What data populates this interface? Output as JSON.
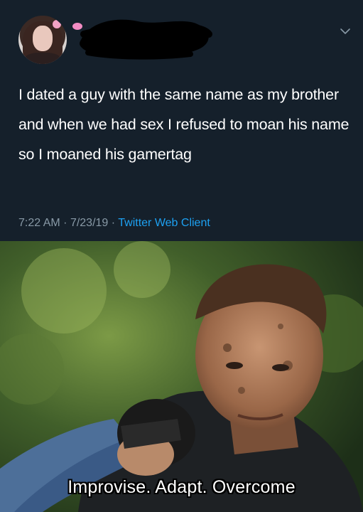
{
  "tweet": {
    "text": "I dated a guy with the same name as my brother and when we had sex I refused to moan his name so I moaned his gamertag",
    "time": "7:22 AM",
    "date": "7/23/19",
    "client": "Twitter Web Client",
    "separator": "·"
  },
  "meme": {
    "caption": "Improvise. Adapt. Overcome"
  },
  "colors": {
    "background": "#15202b",
    "text": "#ffffff",
    "meta": "#8899a6",
    "link": "#1da1f2"
  },
  "icons": {
    "chevron": "chevron-down-icon"
  }
}
